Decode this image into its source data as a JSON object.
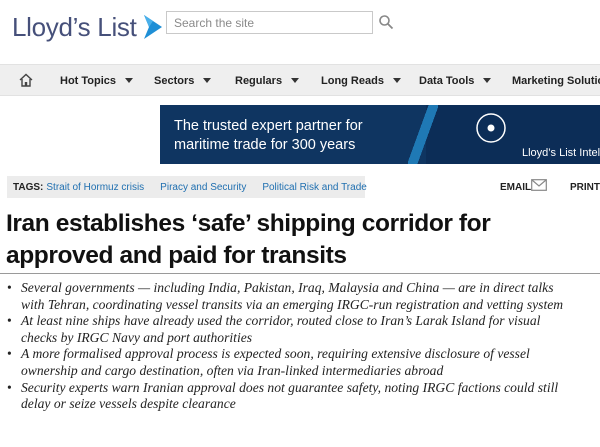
{
  "header": {
    "logo_text": "Lloyd’s List",
    "search_placeholder": "Search the site",
    "search_icon": "search-icon"
  },
  "nav": {
    "home_icon": "home-icon",
    "items": [
      {
        "label": "Hot Topics"
      },
      {
        "label": "Sectors"
      },
      {
        "label": "Regulars"
      },
      {
        "label": "Long Reads"
      },
      {
        "label": "Data Tools"
      },
      {
        "label": "Marketing Solutions"
      }
    ]
  },
  "banner": {
    "line1": "The trusted expert partner for",
    "line2": "maritime trade for 300 years",
    "brand": "Lloyd’s List Intelligence"
  },
  "tags": {
    "label": "TAGS:",
    "items": [
      "Strait of Hormuz crisis",
      "Piracy and Security",
      "Political Risk and Trade"
    ]
  },
  "tools": {
    "email_label": "EMAIL",
    "print_label": "PRINT"
  },
  "article": {
    "headline": "Iran establishes ‘safe’ shipping corridor for approved and paid for transits",
    "bullets": [
      "Several governments — including India, Pakistan, Iraq, Malaysia and China — are in direct talks with Tehran, coordinating vessel transits via an emerging IRGC-run registration and vetting system",
      "At least nine ships have already used the corridor, routed close to Iran’s Larak Island for visual checks by IRGC Navy and port authorities",
      "A more formalised approval process is expected soon, requiring extensive disclosure of vessel ownership and cargo destination, often via Iran-linked intermediaries abroad",
      "Security experts warn Iranian approval does not guarantee safety, noting IRGC factions could still delay or seize vessels despite clearance"
    ]
  },
  "colors": {
    "brand": "#46507a",
    "link": "#1f6fb0",
    "banner_bg": "#0f3561",
    "nav_bg": "#efefef"
  }
}
